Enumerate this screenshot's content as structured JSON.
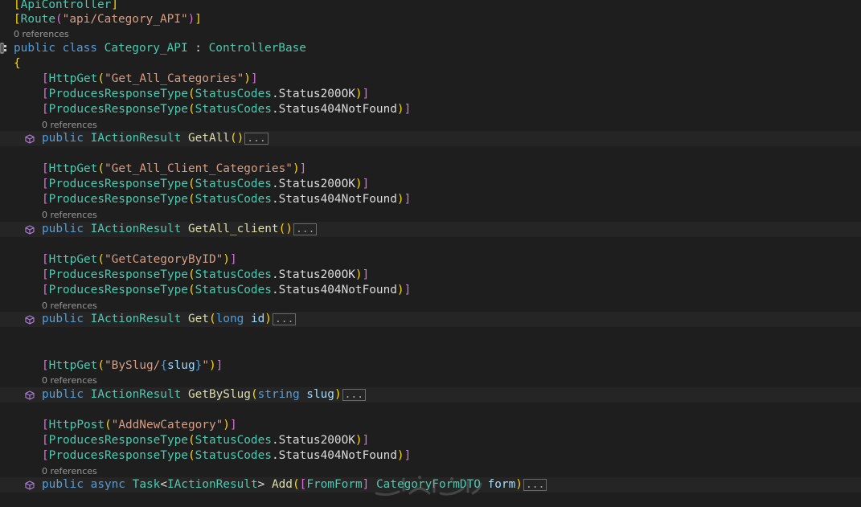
{
  "colors": {
    "background": "#1e1e1e",
    "highlight_line": "#252526",
    "keyword": "#569cd6",
    "type": "#4ec9b0",
    "string": "#d69d85",
    "method": "#dcdcaa",
    "parameter": "#9cdcfe",
    "text": "#dcdcdc",
    "codelens": "#999999"
  },
  "header": {
    "attr_api_controller": "ApiController",
    "attr_route": "Route",
    "route_value": "\"api/Category_API\"",
    "refs": "0 references",
    "kw_public": "public",
    "kw_class": "class",
    "class_name": "Category_API",
    "colon": ":",
    "base_class": "ControllerBase",
    "open_brace": "{"
  },
  "common": {
    "produces": "ProducesResponseType",
    "status_codes": "StatusCodes",
    "status_200": "Status200OK",
    "status_404": "Status404NotFound",
    "refs": "0 references",
    "kw_public": "public",
    "kw_async": "async",
    "kw_long": "long",
    "kw_string": "string",
    "return_type": "IActionResult",
    "task": "Task",
    "ellipsis": "..."
  },
  "methods": [
    {
      "http_attr": "HttpGet",
      "route": "\"Get_All_Categories\"",
      "name": "GetAll",
      "params": ""
    },
    {
      "http_attr": "HttpGet",
      "route": "\"Get_All_Client_Categories\"",
      "name": "GetAll_client",
      "params": ""
    },
    {
      "http_attr": "HttpGet",
      "route": "\"GetCategoryByID\"",
      "name": "Get",
      "param_name": "id"
    },
    {
      "http_attr": "HttpGet",
      "route_prefix": "\"BySlug/",
      "route_brace_open": "{",
      "route_token": "slug",
      "route_brace_close": "}",
      "route_suffix": "\"",
      "name": "GetBySlug",
      "param_name": "slug"
    },
    {
      "http_attr": "HttpPost",
      "route": "\"AddNewCategory\"",
      "name": "Add",
      "from_form": "FromForm",
      "param_type": "CategoryFormDTO",
      "param_name": "form"
    }
  ]
}
